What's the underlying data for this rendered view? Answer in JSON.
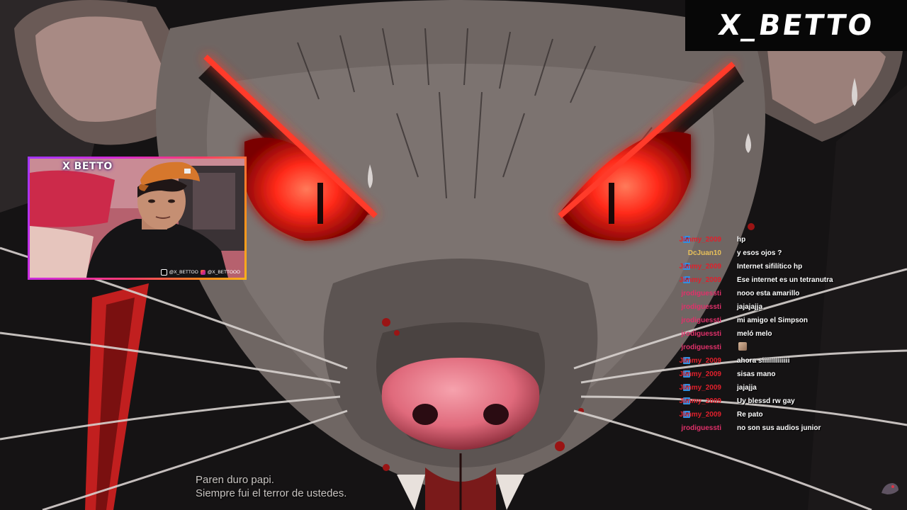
{
  "overlay": {
    "logo_text": "X_BETTO",
    "webcam_brand": "X BETTO",
    "socials": {
      "tiktok": "@X_BETTOO",
      "instagram": "@X_BETTOOO"
    }
  },
  "chat": {
    "messages": [
      {
        "user": "Jimmy_2009",
        "text": "hp",
        "color": "#e0202c",
        "badge": true
      },
      {
        "user": "DcJuan10",
        "text": "y esos ojos ?",
        "color": "#e8c05a",
        "badge": false
      },
      {
        "user": "Jimmy_2009",
        "text": "Internet sifilítico hp",
        "color": "#e0202c",
        "badge": true
      },
      {
        "user": "Jimmy_2009",
        "text": "Ese internet es un tetranutra",
        "color": "#e0202c",
        "badge": true
      },
      {
        "user": "jrodiguessti",
        "text": "nooo esta amarillo",
        "color": "#e0306a",
        "badge": false
      },
      {
        "user": "jrodiguessti",
        "text": "jajajajja",
        "color": "#e0306a",
        "badge": false
      },
      {
        "user": "jrodiguessti",
        "text": "mi amigo el Simpson",
        "color": "#e0306a",
        "badge": false
      },
      {
        "user": "jrodiguessti",
        "text": "meló melo",
        "color": "#e0306a",
        "badge": false
      },
      {
        "user": "jrodiguessti",
        "text": "",
        "color": "#e0306a",
        "badge": false,
        "emote": "emote-icon"
      },
      {
        "user": "Jimmy_2009",
        "text": "ahora siiiiiiiiiiiiii",
        "color": "#e0202c",
        "badge": true
      },
      {
        "user": "Jimmy_2009",
        "text": "sisas mano",
        "color": "#e0202c",
        "badge": true
      },
      {
        "user": "Jimmy_2009",
        "text": "jajajja",
        "color": "#e0202c",
        "badge": true
      },
      {
        "user": "Jimmy_2009",
        "text": "Uy blessd rw gay",
        "color": "#e0202c",
        "badge": true
      },
      {
        "user": "Jimmy_2009",
        "text": "Re pato",
        "color": "#e0202c",
        "badge": true
      },
      {
        "user": "jrodiguessti",
        "text": "no son sus audios junior",
        "color": "#e0306a",
        "badge": false
      }
    ]
  },
  "subtitles": {
    "line1": "Paren duro papi.",
    "line2": "Siempre fui el terror de ustedes."
  },
  "colors": {
    "eye": "#ff2a1a",
    "nose": "#e9788a",
    "webcam_border": [
      "#a236ff",
      "#ff3b6a",
      "#ffb21c"
    ]
  }
}
